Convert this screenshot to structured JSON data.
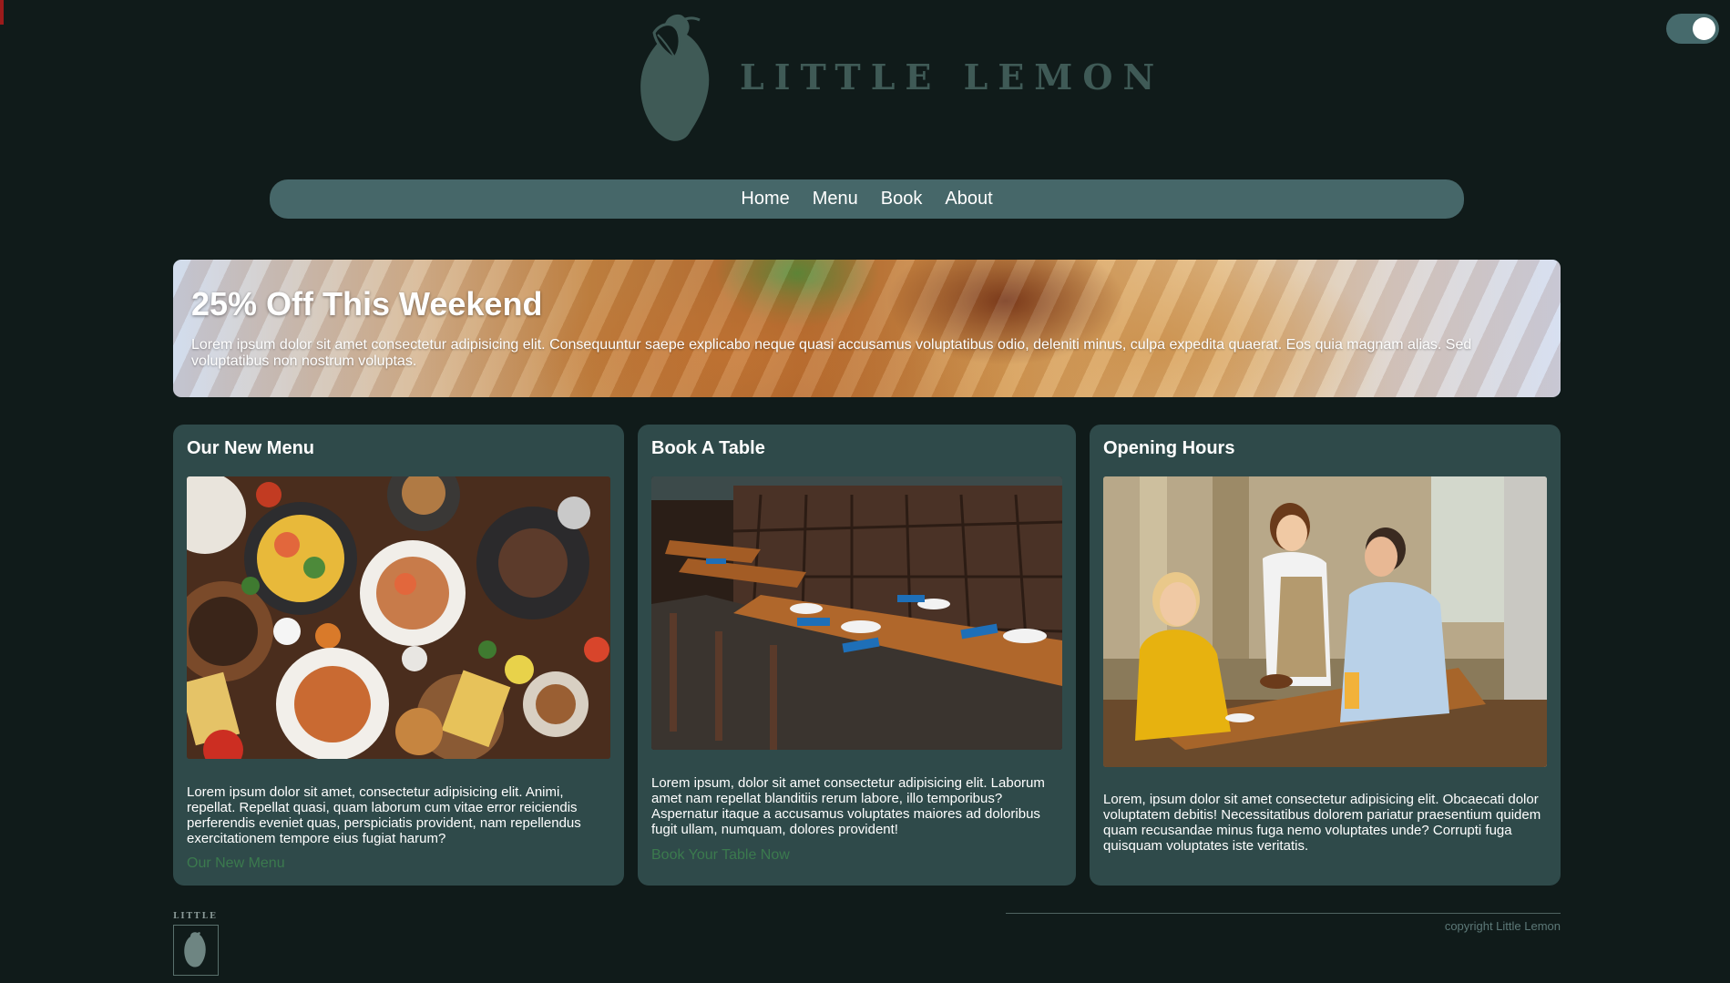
{
  "brand": {
    "name": "LITTLE LEMON",
    "footer_logo_text": "LITTLE"
  },
  "theme_toggle": {
    "state": "on"
  },
  "nav": {
    "items": [
      {
        "label": "Home"
      },
      {
        "label": "Menu"
      },
      {
        "label": "Book"
      },
      {
        "label": "About"
      }
    ]
  },
  "banner": {
    "title": "25% Off This Weekend",
    "text": "Lorem ipsum dolor sit amet consectetur adipisicing elit. Consequuntur saepe explicabo neque quasi accusamus voluptatibus odio, deleniti minus, culpa expedita quaerat. Eos quia magnam alias. Sed voluptatibus non nostrum voluptas."
  },
  "cards": [
    {
      "title": "Our New Menu",
      "text": "Lorem ipsum dolor sit amet, consectetur adipisicing elit. Animi, repellat. Repellat quasi, quam laborum cum vitae error reiciendis perferendis eveniet quas, perspiciatis provident, nam repellendus exercitationem tempore eius fugiat harum?",
      "link": "Our New Menu"
    },
    {
      "title": "Book A Table",
      "text": "Lorem ipsum, dolor sit amet consectetur adipisicing elit. Laborum amet nam repellat blanditiis rerum labore, illo temporibus? Aspernatur itaque a accusamus voluptates maiores ad doloribus fugit ullam, numquam, dolores provident!",
      "link": "Book Your Table Now"
    },
    {
      "title": "Opening Hours",
      "text": "Lorem, ipsum dolor sit amet consectetur adipisicing elit. Obcaecati dolor voluptatem debitis! Necessitatibus dolorem pariatur praesentium quidem quam recusandae minus fuga nemo voluptates unde? Corrupti fuga quisquam voluptates iste veritatis."
    }
  ],
  "footer": {
    "copyright": "copyright Little Lemon"
  },
  "colors": {
    "background": "#101b1a",
    "nav": "#466769",
    "card": "#2f4a4a",
    "logo": "#3f5a56",
    "link": "#3b7a4e"
  }
}
